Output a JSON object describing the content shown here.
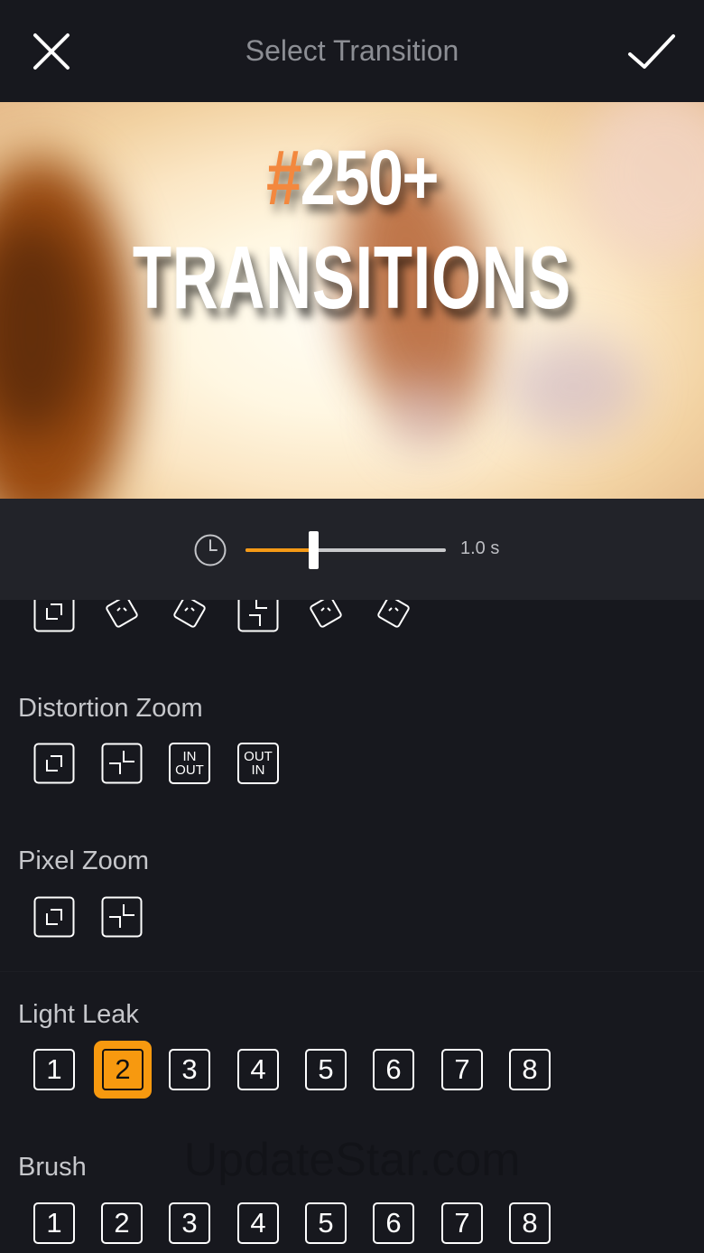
{
  "topbar": {
    "title": "Select Transition",
    "close_icon": "close-icon",
    "confirm_icon": "checkmark-icon"
  },
  "preview": {
    "promo_hash": "#",
    "promo_number": "250+",
    "promo_subtitle": "TRANSITIONS"
  },
  "duration": {
    "clock_icon": "clock-icon",
    "value_label": "1.0 s",
    "slider_fraction": 0.34,
    "accent_color": "#f59a16"
  },
  "sections": {
    "distortion_zoom": {
      "label": "Distortion Zoom",
      "tile3": {
        "line1": "IN",
        "line2": "OUT"
      },
      "tile4": {
        "line1": "OUT",
        "line2": "IN"
      }
    },
    "pixel_zoom": {
      "label": "Pixel Zoom"
    },
    "light_leak": {
      "label": "Light Leak",
      "items": [
        "1",
        "2",
        "3",
        "4",
        "5",
        "6",
        "7",
        "8"
      ],
      "selected": "2"
    },
    "brush": {
      "label": "Brush",
      "items": [
        "1",
        "2",
        "3",
        "4",
        "5",
        "6",
        "7",
        "8"
      ]
    }
  },
  "watermark": "UpdateStar.com",
  "selected_color": "#f7990f"
}
